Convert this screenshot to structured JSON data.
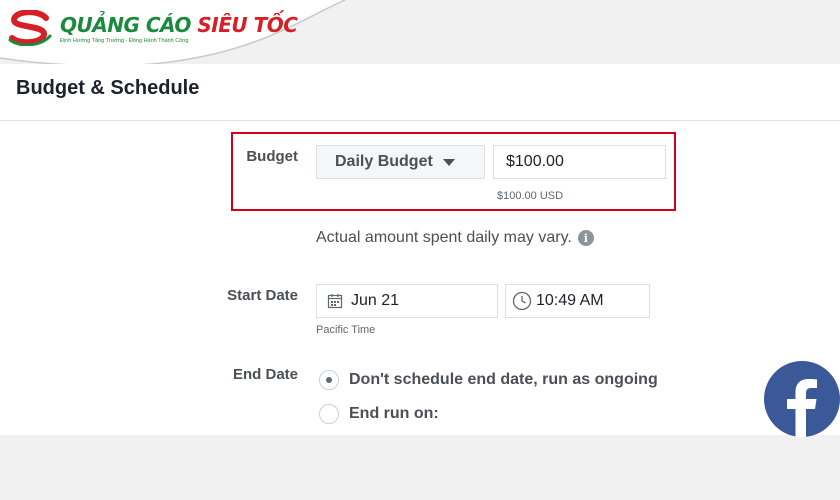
{
  "brand": {
    "name_part1": "QUẢNG CÁO",
    "name_part2": "SIÊU TỐC",
    "tagline": "Định Hướng Tăng Trưởng - Đồng Hành Thành Công"
  },
  "section": {
    "title": "Budget & Schedule"
  },
  "budget": {
    "label": "Budget",
    "type_selected": "Daily Budget",
    "amount_value": "$100.00",
    "amount_hint": "$100.00 USD",
    "note": "Actual amount spent daily may vary.",
    "highlight_color": "#d0021b"
  },
  "start_date": {
    "label": "Start Date",
    "date_value": "Jun 21",
    "time_value": "10:49 AM",
    "timezone": "Pacific Time"
  },
  "end_date": {
    "label": "End Date",
    "options": [
      {
        "label": "Don't schedule end date, run as ongoing",
        "selected": true
      },
      {
        "label": "End run on:",
        "selected": false
      }
    ]
  },
  "icons": {
    "calendar": "calendar-icon",
    "clock": "clock-icon",
    "info": "info-icon",
    "caret": "caret-down-icon",
    "facebook": "facebook-logo-icon"
  },
  "colors": {
    "facebook_blue": "#3b5998",
    "brand_green": "#1a8a3c",
    "brand_red": "#d62027"
  }
}
